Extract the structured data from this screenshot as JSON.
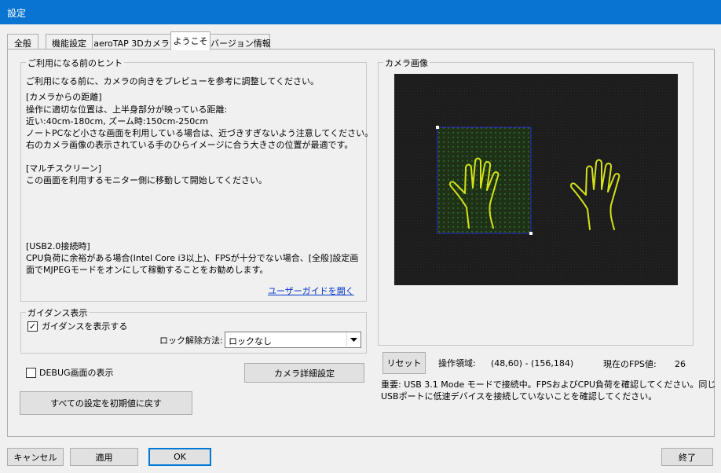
{
  "window": {
    "title": "設定"
  },
  "tabs": [
    {
      "label": "全般"
    },
    {
      "label": "機能設定"
    },
    {
      "label": "aeroTAP 3Dカメラ"
    },
    {
      "label": "ようこそ"
    },
    {
      "label": "バージョン情報"
    }
  ],
  "hints": {
    "legend": "ご利用になる前のヒント",
    "intro": "ご利用になる前に、カメラの向きをプレビューを参考に調整してください。",
    "distance_title": "[カメラからの距離]",
    "distance_line1": "操作に適切な位置は、上半身部分が映っている距離:",
    "distance_line2": "近い:40cm-180cm, ズーム時:150cm-250cm",
    "distance_line3": "ノートPCなど小さな画面を利用している場合は、近づきすぎないよう注意してください。",
    "distance_line4": "右のカメラ画像の表示されている手のひらイメージに合う大きさの位置が最適です。",
    "multi_title": "[マルチスクリーン]",
    "multi_line1": "この画面を利用するモニター側に移動して開始してください。",
    "usb_title": "[USB2.0接続時]",
    "usb_line1": "CPU負荷に余裕がある場合(Intel Core i3以上)、FPSが十分でない場合、[全般]設定画",
    "usb_line2": "面でMJPEGモードをオンにして稼動することをお勧めします。",
    "guide_link": "ユーザーガイドを開く"
  },
  "guidance": {
    "legend": "ガイダンス表示",
    "show_checkbox_label": "ガイダンスを表示する",
    "show_checked": true,
    "unlock_label": "ロック解除方法:",
    "unlock_value": "ロックなし"
  },
  "debug": {
    "label": "DEBUG画面の表示",
    "checked": false
  },
  "buttons": {
    "camera_detail": "カメラ詳細設定",
    "reset_all": "すべての設定を初期値に戻す",
    "reset": "リセット",
    "cancel": "キャンセル",
    "apply": "適用",
    "ok": "OK",
    "exit": "終了"
  },
  "camera": {
    "legend": "カメラ画像",
    "area_label": "操作領域:",
    "area_value": "(48,60) - (156,184)",
    "fps_label": "現在のFPS値:",
    "fps_value": "26",
    "notice_line1": "重要: USB 3.1 Mode モードで接続中。FPSおよびCPU負荷を確認してください。同じ",
    "notice_line2": "USBポートに低速デバイスを接続していないことを確認してください。"
  },
  "colors": {
    "titlebar": "#0a74d2",
    "hand_outline": "#d4e21a",
    "region_border": "#2a2ac8",
    "grid_dots": "#3fa83f",
    "link": "#0033cc"
  }
}
